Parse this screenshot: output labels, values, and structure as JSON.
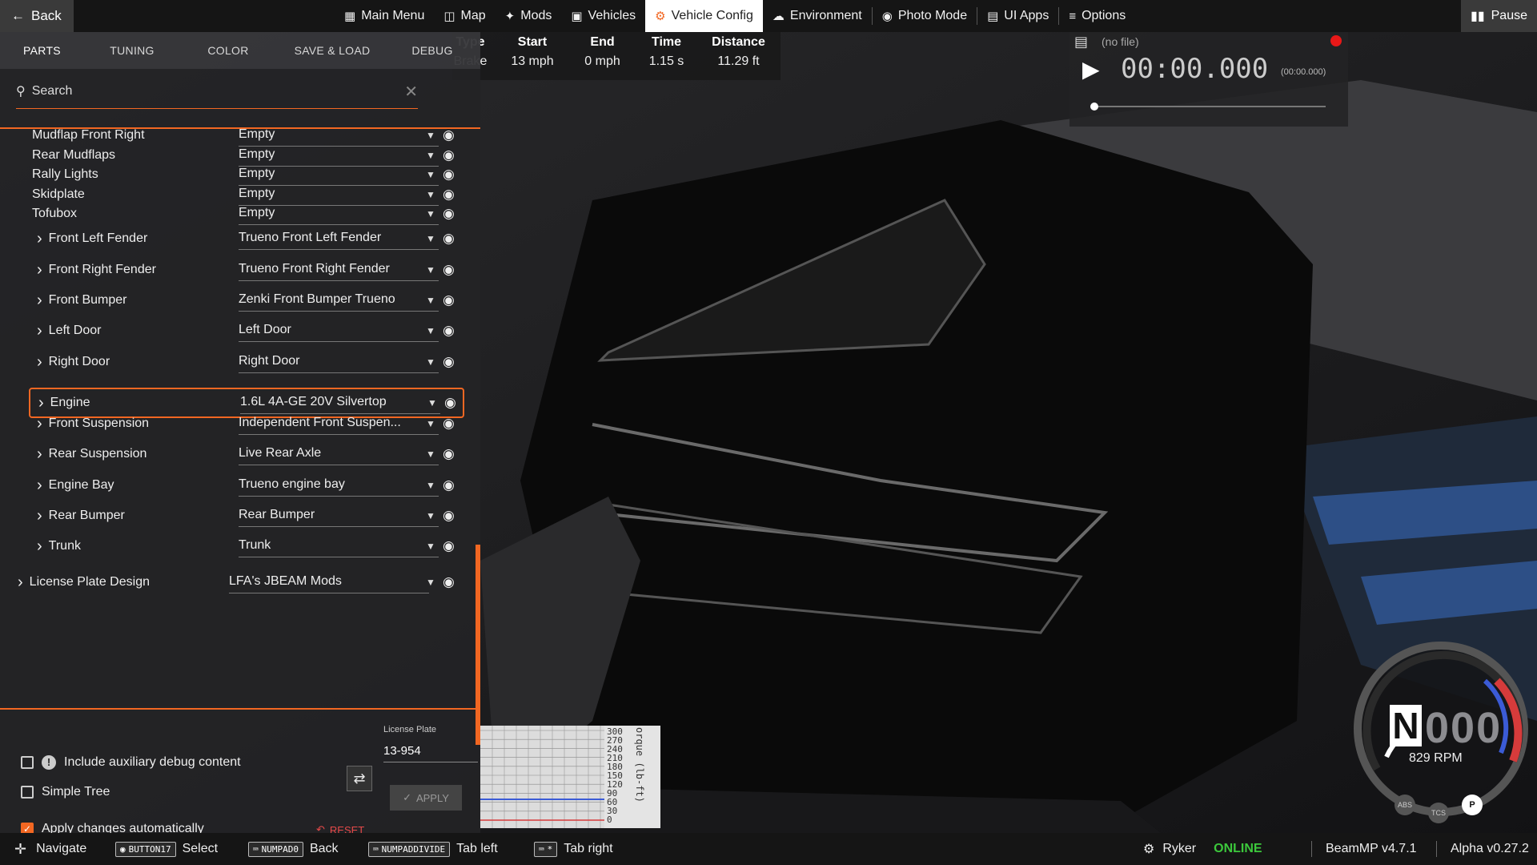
{
  "topbar": {
    "back_label": "Back",
    "nav": [
      {
        "label": "Main Menu",
        "icon": "grid-icon"
      },
      {
        "label": "Map",
        "icon": "map-icon"
      },
      {
        "label": "Mods",
        "icon": "puzzle-icon"
      },
      {
        "label": "Vehicles",
        "icon": "car-icon"
      },
      {
        "label": "Vehicle Config",
        "icon": "engine-icon",
        "active": true
      },
      {
        "label": "Environment",
        "icon": "weather-icon"
      },
      {
        "label": "Photo Mode",
        "icon": "camera-icon"
      },
      {
        "label": "UI Apps",
        "icon": "apps-icon"
      },
      {
        "label": "Options",
        "icon": "sliders-icon"
      }
    ],
    "pause_label": "Pause",
    "accent": "#f26722"
  },
  "panel": {
    "tabs": [
      "PARTS",
      "TUNING",
      "COLOR",
      "SAVE & LOAD",
      "DEBUG"
    ],
    "active_tab": "PARTS",
    "search_placeholder": "Search",
    "parts": [
      {
        "name": "Mudflap Front Right",
        "value": "Empty",
        "expandable": false
      },
      {
        "name": "Rear Mudflaps",
        "value": "Empty",
        "expandable": false
      },
      {
        "name": "Rally Lights",
        "value": "Empty",
        "expandable": false
      },
      {
        "name": "Skidplate",
        "value": "Empty",
        "expandable": false
      },
      {
        "name": "Tofubox",
        "value": "Empty",
        "expandable": false
      },
      {
        "name": "Front Left Fender",
        "value": "Trueno Front Left Fender",
        "expandable": true
      },
      {
        "name": "Front Right Fender",
        "value": "Trueno Front Right Fender",
        "expandable": true
      },
      {
        "name": "Front Bumper",
        "value": "Zenki Front Bumper Trueno",
        "expandable": true
      },
      {
        "name": "Left Door",
        "value": "Left Door",
        "expandable": true
      },
      {
        "name": "Right Door",
        "value": "Right Door",
        "expandable": true
      },
      {
        "name": "Engine",
        "value": "1.6L 4A-GE 20V Silvertop",
        "expandable": true,
        "highlight": true
      },
      {
        "name": "Front Suspension",
        "value": "Independent Front Suspen...",
        "expandable": true
      },
      {
        "name": "Rear Suspension",
        "value": "Live Rear Axle",
        "expandable": true
      },
      {
        "name": "Engine Bay",
        "value": "Trueno engine bay",
        "expandable": true
      },
      {
        "name": "Rear Bumper",
        "value": "Rear Bumper",
        "expandable": true
      },
      {
        "name": "Trunk",
        "value": "Trunk",
        "expandable": true
      },
      {
        "name": "License Plate Design",
        "value": "LFA's JBEAM Mods",
        "expandable": true
      }
    ],
    "options": [
      {
        "label": "Include auxiliary debug content",
        "checked": false
      },
      {
        "label": "Simple Tree",
        "checked": false
      },
      {
        "label": "Apply changes automatically",
        "checked": true
      }
    ],
    "license_label": "License Plate",
    "license_value": "13-954",
    "reset_label": "RESET",
    "apply_label": "APPLY"
  },
  "info_table": {
    "headers": [
      "Type",
      "Start",
      "End",
      "Time",
      "Distance"
    ],
    "values": [
      "Brake",
      "13 mph",
      "0 mph",
      "1.15 s",
      "11.29 ft"
    ]
  },
  "replay": {
    "file": "(no file)",
    "time": "00:00.000",
    "time_small": "(00:00.000)"
  },
  "graph": {
    "ticks": [
      "300",
      "270",
      "240",
      "210",
      "180",
      "150",
      "120",
      "90",
      "60",
      "30",
      "0"
    ],
    "axis_label": "orque (lb-ft)"
  },
  "gauge": {
    "gear": "N",
    "speed": "000",
    "rpm": "829 RPM",
    "indicators": [
      "ABS",
      "TCS",
      "P"
    ]
  },
  "statusbar": {
    "hints": [
      {
        "key": "BUTTON17",
        "label": "Select"
      },
      {
        "key": "NUMPAD0",
        "label": "Back"
      },
      {
        "key": "NUMPADDIVIDE",
        "label": "Tab left"
      },
      {
        "key": "*",
        "label": "Tab right"
      }
    ],
    "navigate_label": "Navigate",
    "user": "Ryker",
    "online": "ONLINE",
    "online_color": "#3cc83c",
    "version": "BeamMP v4.7.1",
    "alpha": "Alpha v0.27.2"
  }
}
